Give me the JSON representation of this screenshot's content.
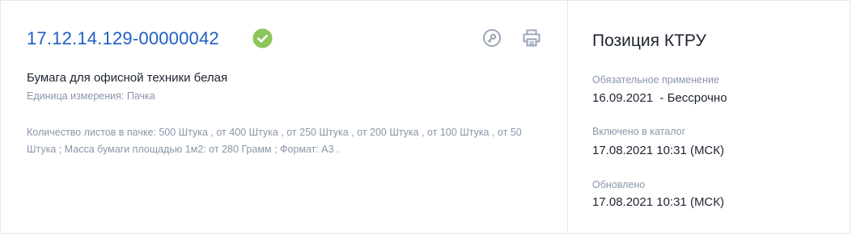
{
  "item": {
    "code": "17.12.14.129-00000042",
    "name": "Бумага для офисной техники белая",
    "unit_line": "Единица измерения: Пачка",
    "characteristics": "Количество листов в пачке: 500 Штука , от 400 Штука , от 250 Штука , от 200 Штука , от 100 Штука , от 50 Штука ; Масса бумаги площадью 1м2: от 280 Грамм ; Формат: А3 .",
    "status_icon": "check-circle-icon",
    "status_color": "#8dc559"
  },
  "toolbar": {
    "key_icon": "key-icon",
    "print_icon": "printer-icon",
    "icon_color": "#9aa6b8"
  },
  "side": {
    "title": "Позиция КТРУ",
    "fields": [
      {
        "label": "Обязательное применение",
        "value": "16.09.2021  - Бессрочно"
      },
      {
        "label": "Включено в каталог",
        "value": "17.08.2021 10:31 (МСК)"
      },
      {
        "label": "Обновлено",
        "value": "17.08.2021 10:31 (МСК)"
      }
    ]
  },
  "colors": {
    "link": "#1f5fc4",
    "text_primary": "#1d2430",
    "text_muted": "#8a96a8",
    "border": "#e3e7ee"
  }
}
